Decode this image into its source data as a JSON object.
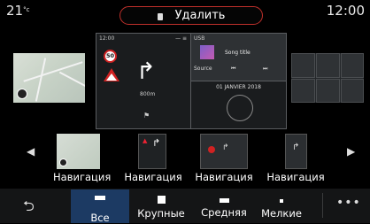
{
  "status_bar": {
    "temperature": "21",
    "temperature_unit": "°c",
    "time": "12:00"
  },
  "delete_action": {
    "label": "Удалить",
    "icon": "trash-icon",
    "accent_color": "#c0302b"
  },
  "preview": {
    "nav_widget": {
      "clock": "12:00",
      "speed_limit": "50",
      "distance": "800m",
      "turn_icon": "turn-right-arrow-icon",
      "warning_icon": "warning-triangle-icon",
      "flag_icon": "destination-flag-icon"
    },
    "media_widget": {
      "source_title": "USB",
      "song": "Song title",
      "source_button": "Source"
    },
    "date_widget": {
      "date": "01 JANVIER 2018"
    }
  },
  "carousel": {
    "items": [
      {
        "label": "Навигация"
      },
      {
        "label": "Навигация"
      },
      {
        "label": "Навигация"
      },
      {
        "label": "Навигация"
      }
    ]
  },
  "bottom_bar": {
    "back_icon": "back-arrow-icon",
    "tabs": [
      {
        "label": "Все",
        "selected": true
      },
      {
        "label": "Крупные",
        "selected": false
      },
      {
        "label": "Средняя",
        "selected": false
      },
      {
        "label": "Мелкие",
        "selected": false
      }
    ],
    "more_icon": "more-dots-icon",
    "selected_color": "#1c3a63"
  }
}
